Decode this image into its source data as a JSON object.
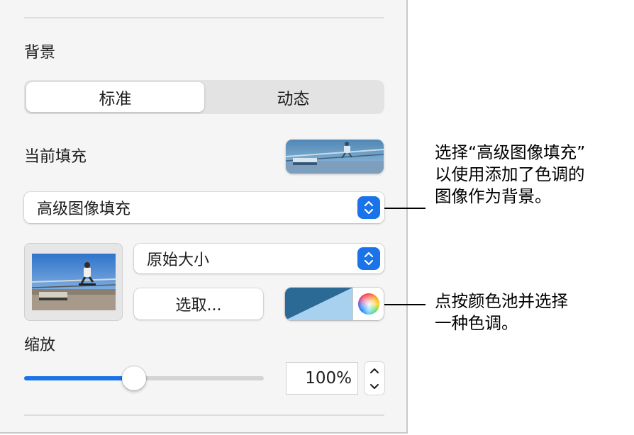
{
  "panel": {
    "background_section": {
      "title": "背景",
      "tabs": [
        {
          "label": "标准",
          "active": true
        },
        {
          "label": "动态",
          "active": false
        }
      ]
    },
    "current_fill": {
      "label": "当前填充"
    },
    "fill_type_popup": {
      "value": "高级图像填充"
    },
    "image_scale_popup": {
      "value": "原始大小"
    },
    "choose_button": {
      "label": "选取..."
    },
    "color_well": {
      "tint_color": "#2b6a95"
    },
    "scale": {
      "label": "缩放",
      "value_text": "100%",
      "slider_level": 0.46
    }
  },
  "callouts": {
    "fill_callout": "选择“高级图像填充”\n以使用添加了色调的\n图像作为背景。",
    "tint_callout": "点按颜色池并选择\n一种色调。"
  },
  "colors": {
    "accent": "#1a73e8",
    "panel_bg": "#f5f5f5"
  }
}
